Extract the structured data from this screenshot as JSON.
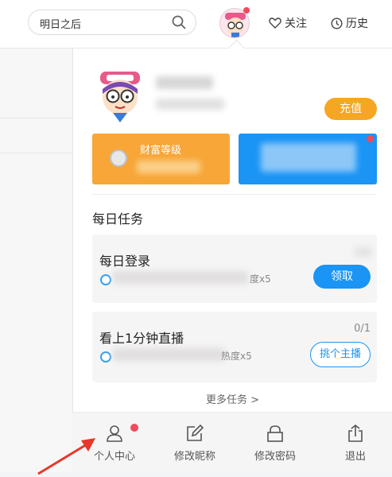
{
  "header": {
    "search_placeholder": "明日之后",
    "follow_label": "关注",
    "history_label": "历史"
  },
  "profile": {
    "recharge_label": "充值"
  },
  "cards": {
    "wealth_label": "财富等级"
  },
  "tasks": {
    "section_title": "每日任务",
    "items": [
      {
        "title": "每日登录",
        "reward": "度x5",
        "progress": "",
        "action": "领取"
      },
      {
        "title": "看上1分钟直播",
        "reward": "热度x5",
        "progress": "0/1",
        "action": "挑个主播"
      }
    ],
    "more_label": "更多任务 >"
  },
  "bottom_nav": [
    {
      "label": "个人中心",
      "icon": "user-icon"
    },
    {
      "label": "修改昵称",
      "icon": "edit-icon"
    },
    {
      "label": "修改密码",
      "icon": "lock-icon"
    },
    {
      "label": "退出",
      "icon": "share-icon"
    }
  ],
  "colors": {
    "accent_blue": "#1a94f5",
    "accent_orange": "#f7a623",
    "badge_red": "#f04a5b"
  }
}
